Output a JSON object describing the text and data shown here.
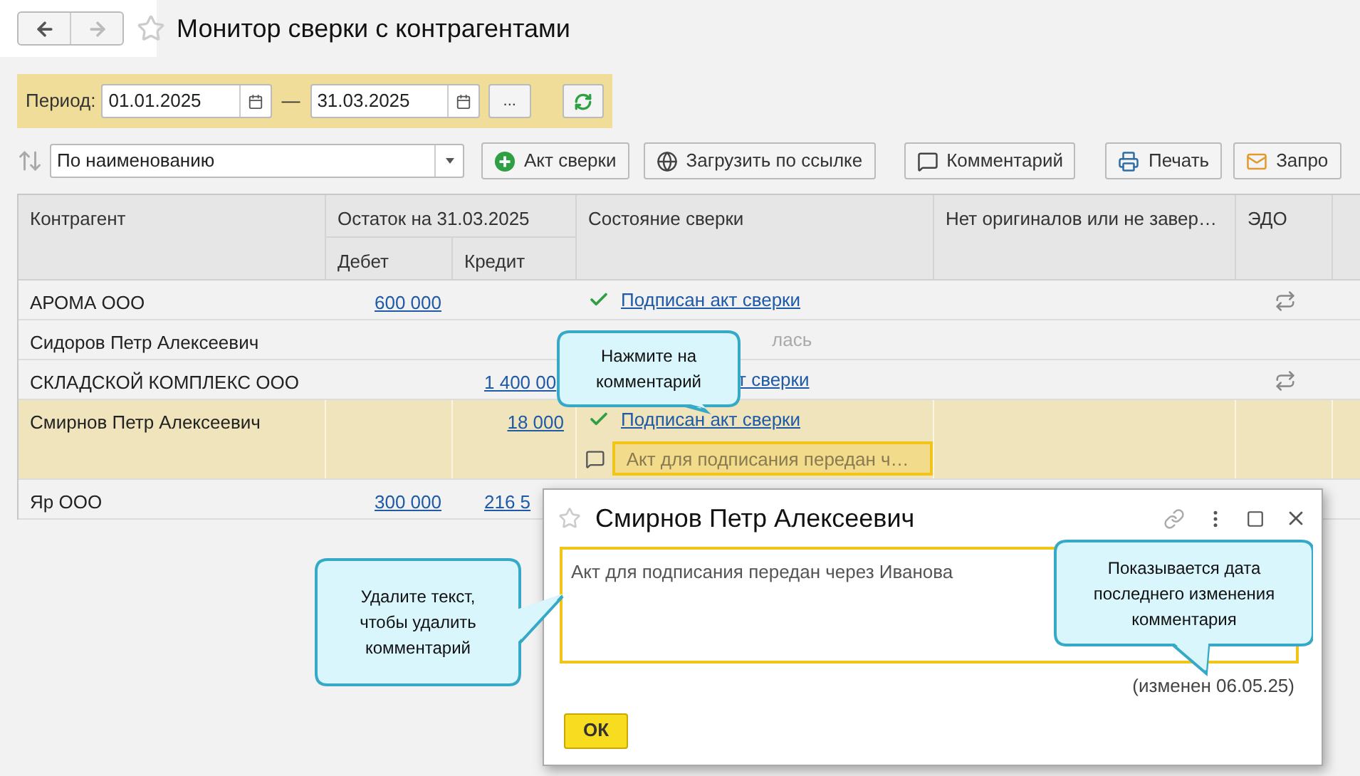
{
  "nav": {
    "back_enabled": true,
    "forward_enabled": false
  },
  "title": "Монитор сверки с контрагентами",
  "period": {
    "label": "Период:",
    "from": "01.01.2025",
    "separator": "—",
    "to": "31.03.2025",
    "more": "..."
  },
  "sort": {
    "value": "По наименованию"
  },
  "toolbar": [
    {
      "kind": "add",
      "label": "Акт сверки"
    },
    {
      "kind": "load",
      "label": "Загрузить по ссылке"
    },
    {
      "kind": "comment",
      "label": "Комментарий"
    },
    {
      "kind": "print",
      "label": "Печать"
    },
    {
      "kind": "mail",
      "label": "Запро"
    }
  ],
  "table": {
    "columns": {
      "name": "Контрагент",
      "balance": "Остаток на 31.03.2025",
      "debit": "Дебет",
      "credit": "Кредит",
      "status": "Состояние сверки",
      "originals": "Нет оригиналов или не завер…",
      "edo": "ЭДО"
    },
    "rows": [
      {
        "name": "АРОМА ООО",
        "debit": "600 000",
        "credit": "",
        "credit_covered": false,
        "status": {
          "kind": "signed",
          "check": true,
          "text": "Подписан акт сверки"
        },
        "edo": true,
        "selected": false
      },
      {
        "name": "Сидоров Петр Алексеевич",
        "debit": "",
        "credit": "",
        "status": {
          "kind": "muted",
          "check": false,
          "text": "лась"
        },
        "edo": false,
        "selected": false
      },
      {
        "name": "СКЛАДСКОЙ КОМПЛЕКС ООО",
        "debit": "",
        "credit": "1 400 00",
        "credit_covered": true,
        "status": {
          "kind": "signed",
          "check": false,
          "text": "т сверки"
        },
        "edo": true,
        "selected": false
      },
      {
        "name": "Смирнов Петр Алексеевич",
        "debit": "",
        "credit": "18 000",
        "credit_covered": false,
        "status": {
          "kind": "signed",
          "check": true,
          "text": "Подписан акт сверки"
        },
        "comment": "Акт для подписания передан ч…",
        "edo": false,
        "selected": true
      },
      {
        "name": "Яр ООО",
        "debit": "300 000",
        "credit": "216 5",
        "credit_covered": true,
        "selected": false
      }
    ]
  },
  "dialog": {
    "title": "Смирнов Петр Алексеевич",
    "text": "Акт для подписания передан через Иванова",
    "modified": "(изменен 06.05.25)",
    "ok": "ОК"
  },
  "callouts": [
    "Нажмите на комментарий",
    "Удалите текст, чтобы удалить комментарий",
    "Показывается дата последнего изменения комментария"
  ]
}
